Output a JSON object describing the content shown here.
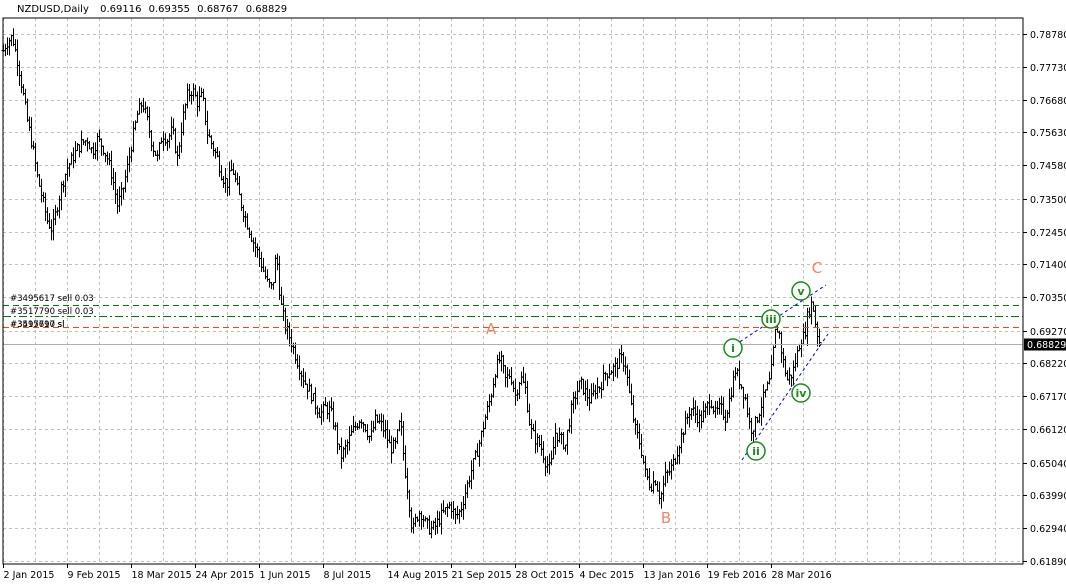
{
  "header": {
    "symbol": "NZDUSD,Daily",
    "open": "0.69116",
    "high": "0.69355",
    "low": "0.68767",
    "close": "0.68829"
  },
  "chart_data": {
    "type": "ohlc",
    "symbol": "NZDUSD",
    "timeframe": "Daily",
    "ylim": [
      0.6189,
      0.7983
    ],
    "y_ticks": [
      "0.78780",
      "0.77730",
      "0.76680",
      "0.75630",
      "0.74580",
      "0.73500",
      "0.72450",
      "0.71400",
      "0.70350",
      "0.69270",
      "0.68220",
      "0.67170",
      "0.66120",
      "0.65040",
      "0.63990",
      "0.62940",
      "0.61890"
    ],
    "x_ticks": [
      "2 Jan 2015",
      "9 Feb 2015",
      "18 Mar 2015",
      "24 Apr 2015",
      "1 Jun 2015",
      "8 Jul 2015",
      "14 Aug 2015",
      "21 Sep 2015",
      "28 Oct 2015",
      "4 Dec 2015",
      "13 Jan 2016",
      "19 Feb 2016",
      "28 Mar 2016"
    ],
    "grid": true,
    "current_price": "0.68829",
    "price_path": [
      [
        0,
        0.78
      ],
      [
        6,
        0.785
      ],
      [
        12,
        0.787
      ],
      [
        18,
        0.778
      ],
      [
        22,
        0.77
      ],
      [
        27,
        0.76
      ],
      [
        32,
        0.752
      ],
      [
        37,
        0.742
      ],
      [
        42,
        0.735
      ],
      [
        47,
        0.728
      ],
      [
        52,
        0.725
      ],
      [
        57,
        0.733
      ],
      [
        62,
        0.74
      ],
      [
        67,
        0.745
      ],
      [
        72,
        0.748
      ],
      [
        77,
        0.751
      ],
      [
        82,
        0.753
      ],
      [
        87,
        0.754
      ],
      [
        92,
        0.75
      ],
      [
        97,
        0.754
      ],
      [
        102,
        0.752
      ],
      [
        107,
        0.748
      ],
      [
        112,
        0.742
      ],
      [
        117,
        0.733
      ],
      [
        122,
        0.737
      ],
      [
        127,
        0.745
      ],
      [
        132,
        0.754
      ],
      [
        137,
        0.762
      ],
      [
        142,
        0.766
      ],
      [
        147,
        0.76
      ],
      [
        152,
        0.752
      ],
      [
        157,
        0.748
      ],
      [
        162,
        0.756
      ],
      [
        167,
        0.754
      ],
      [
        172,
        0.757
      ],
      [
        177,
        0.748
      ],
      [
        182,
        0.76
      ],
      [
        187,
        0.768
      ],
      [
        192,
        0.77
      ],
      [
        197,
        0.766
      ],
      [
        202,
        0.768
      ],
      [
        207,
        0.756
      ],
      [
        212,
        0.752
      ],
      [
        217,
        0.748
      ],
      [
        222,
        0.742
      ],
      [
        227,
        0.74
      ],
      [
        232,
        0.745
      ],
      [
        237,
        0.738
      ],
      [
        242,
        0.732
      ],
      [
        247,
        0.727
      ],
      [
        252,
        0.722
      ],
      [
        257,
        0.718
      ],
      [
        262,
        0.713
      ],
      [
        267,
        0.708
      ],
      [
        272,
        0.706
      ],
      [
        276,
        0.718
      ],
      [
        280,
        0.702
      ],
      [
        285,
        0.694
      ],
      [
        290,
        0.69
      ],
      [
        295,
        0.685
      ],
      [
        300,
        0.68
      ],
      [
        305,
        0.676
      ],
      [
        310,
        0.673
      ],
      [
        315,
        0.669
      ],
      [
        320,
        0.666
      ],
      [
        325,
        0.668
      ],
      [
        330,
        0.667
      ],
      [
        335,
        0.661
      ],
      [
        340,
        0.652
      ],
      [
        345,
        0.655
      ],
      [
        350,
        0.659
      ],
      [
        355,
        0.662
      ],
      [
        360,
        0.665
      ],
      [
        365,
        0.662
      ],
      [
        370,
        0.658
      ],
      [
        375,
        0.664
      ],
      [
        380,
        0.663
      ],
      [
        385,
        0.66
      ],
      [
        390,
        0.655
      ],
      [
        395,
        0.656
      ],
      [
        400,
        0.664
      ],
      [
        404,
        0.65
      ],
      [
        408,
        0.64
      ],
      [
        412,
        0.628
      ],
      [
        416,
        0.633
      ],
      [
        420,
        0.635
      ],
      [
        425,
        0.631
      ],
      [
        430,
        0.629
      ],
      [
        435,
        0.63
      ],
      [
        440,
        0.633
      ],
      [
        445,
        0.635
      ],
      [
        450,
        0.637
      ],
      [
        455,
        0.633
      ],
      [
        460,
        0.635
      ],
      [
        465,
        0.641
      ],
      [
        470,
        0.647
      ],
      [
        475,
        0.652
      ],
      [
        480,
        0.658
      ],
      [
        485,
        0.665
      ],
      [
        490,
        0.671
      ],
      [
        495,
        0.68
      ],
      [
        500,
        0.684
      ],
      [
        505,
        0.677
      ],
      [
        510,
        0.679
      ],
      [
        515,
        0.672
      ],
      [
        520,
        0.678
      ],
      [
        525,
        0.674
      ],
      [
        530,
        0.661
      ],
      [
        535,
        0.658
      ],
      [
        540,
        0.656
      ],
      [
        545,
        0.651
      ],
      [
        550,
        0.648
      ],
      [
        555,
        0.66
      ],
      [
        560,
        0.658
      ],
      [
        565,
        0.656
      ],
      [
        570,
        0.666
      ],
      [
        575,
        0.672
      ],
      [
        580,
        0.676
      ],
      [
        585,
        0.673
      ],
      [
        590,
        0.67
      ],
      [
        595,
        0.674
      ],
      [
        600,
        0.675
      ],
      [
        605,
        0.679
      ],
      [
        610,
        0.68
      ],
      [
        615,
        0.681
      ],
      [
        620,
        0.684
      ],
      [
        625,
        0.682
      ],
      [
        630,
        0.67
      ],
      [
        635,
        0.661
      ],
      [
        640,
        0.656
      ],
      [
        645,
        0.647
      ],
      [
        650,
        0.643
      ],
      [
        655,
        0.645
      ],
      [
        660,
        0.639
      ],
      [
        665,
        0.646
      ],
      [
        670,
        0.648
      ],
      [
        675,
        0.652
      ],
      [
        680,
        0.658
      ],
      [
        685,
        0.663
      ],
      [
        690,
        0.668
      ],
      [
        695,
        0.666
      ],
      [
        700,
        0.664
      ],
      [
        705,
        0.667
      ],
      [
        710,
        0.671
      ],
      [
        715,
        0.666
      ],
      [
        720,
        0.668
      ],
      [
        725,
        0.665
      ],
      [
        730,
        0.672
      ],
      [
        735,
        0.68
      ],
      [
        740,
        0.676
      ],
      [
        745,
        0.671
      ],
      [
        750,
        0.661
      ],
      [
        755,
        0.663
      ],
      [
        760,
        0.668
      ],
      [
        765,
        0.673
      ],
      [
        770,
        0.677
      ],
      [
        775,
        0.692
      ],
      [
        778,
        0.694
      ],
      [
        782,
        0.684
      ],
      [
        787,
        0.677
      ],
      [
        792,
        0.679
      ],
      [
        796,
        0.684
      ],
      [
        800,
        0.69
      ],
      [
        804,
        0.691
      ],
      [
        808,
        0.699
      ],
      [
        812,
        0.702
      ],
      [
        816,
        0.693
      ],
      [
        820,
        0.688
      ]
    ],
    "trade_lines": [
      {
        "label": "#3495617 sell 0.03",
        "price": 0.701,
        "color": "#008000",
        "style": "dash"
      },
      {
        "label": "#3517790 sell 0.03",
        "price": 0.6975,
        "color": "#008000",
        "style": "dashdot"
      },
      {
        "label": "#3517790 sl",
        "price": 0.694,
        "color": "#ff4500",
        "style": "dash"
      },
      {
        "label": "#3495617 sl",
        "price": 0.694,
        "color": "#ff4500",
        "style": "dash"
      }
    ],
    "wave_labels": [
      {
        "text": "A",
        "type": "letter"
      },
      {
        "text": "B",
        "type": "letter"
      },
      {
        "text": "C",
        "type": "letter"
      },
      {
        "text": "i",
        "type": "circled"
      },
      {
        "text": "ii",
        "type": "circled"
      },
      {
        "text": "iii",
        "type": "circled"
      },
      {
        "text": "iv",
        "type": "circled"
      },
      {
        "text": "v",
        "type": "circled"
      }
    ],
    "colors": {
      "bars": "#000000",
      "grid": "#c0c0c0",
      "letter_labels": "#f4845f",
      "circle_labels": "#1a8a1a",
      "channel": "#0000cd",
      "price_box_bg": "#000000",
      "price_box_fg": "#ffffff"
    }
  }
}
